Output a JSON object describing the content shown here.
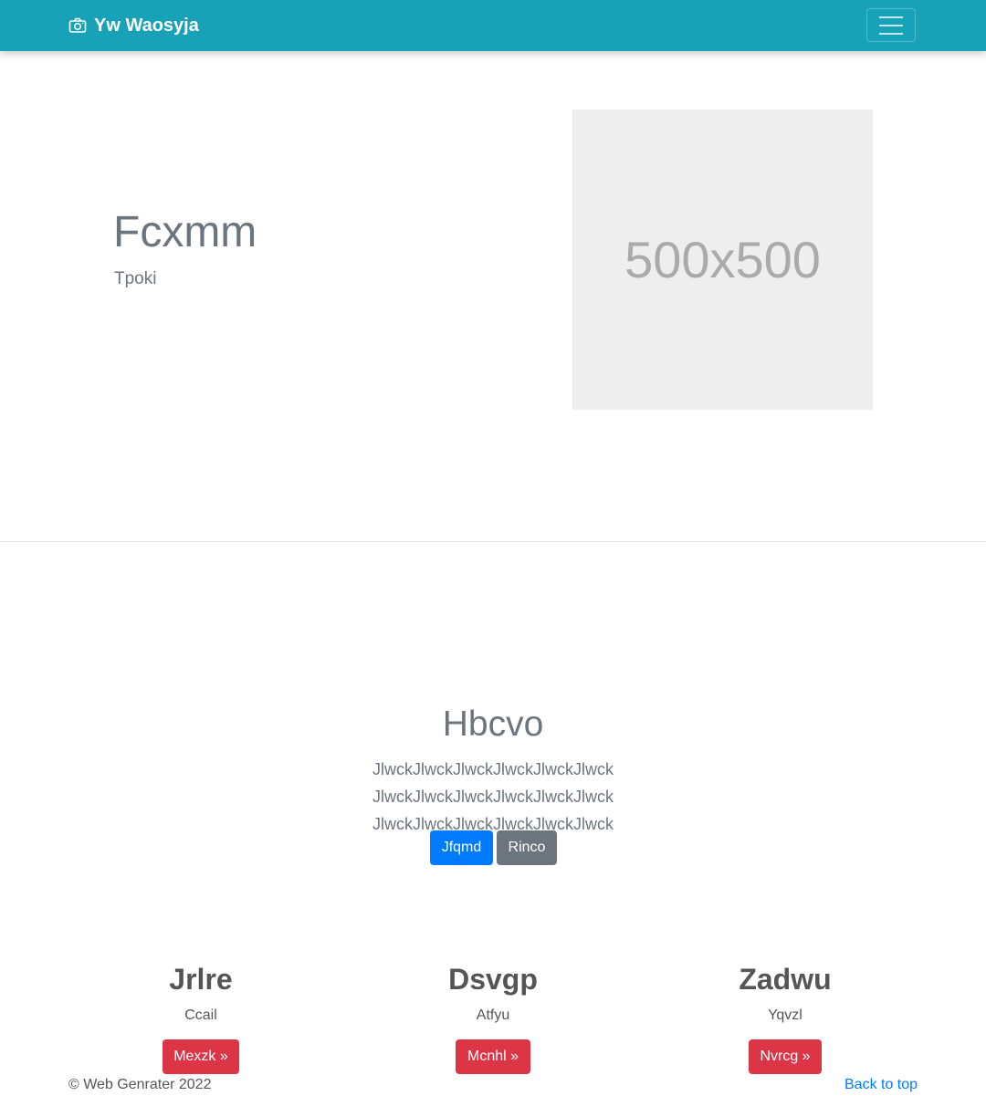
{
  "navbar": {
    "brand": "Yw Waosyja",
    "brand_icon": "camera-icon",
    "toggler_icon": "hamburger-icon"
  },
  "hero": {
    "title": "Fcxmm",
    "subtitle": "Tpoki",
    "image_label": "500x500"
  },
  "section": {
    "title": "Hbcvo",
    "text": "JlwckJlwckJlwckJlwckJlwckJlwck JlwckJlwckJlwckJlwckJlwckJlwck JlwckJlwckJlwckJlwckJlwckJlwck",
    "primary_button": "Jfqmd",
    "secondary_button": "Rinco"
  },
  "columns": [
    {
      "heading": "Jrlre",
      "text": "Ccail",
      "button": "Mexzk »"
    },
    {
      "heading": "Dsvgp",
      "text": "Atfyu",
      "button": "Mcnhl »"
    },
    {
      "heading": "Zadwu",
      "text": "Yqvzl",
      "button": "Nvrcg »"
    }
  ],
  "footer": {
    "copyright": "© Web Genrater 2022",
    "back_to_top": "Back to top"
  },
  "colors": {
    "navbar": "#17a2b8",
    "primary": "#007bff",
    "secondary": "#6c757d",
    "danger": "#dc3545"
  }
}
